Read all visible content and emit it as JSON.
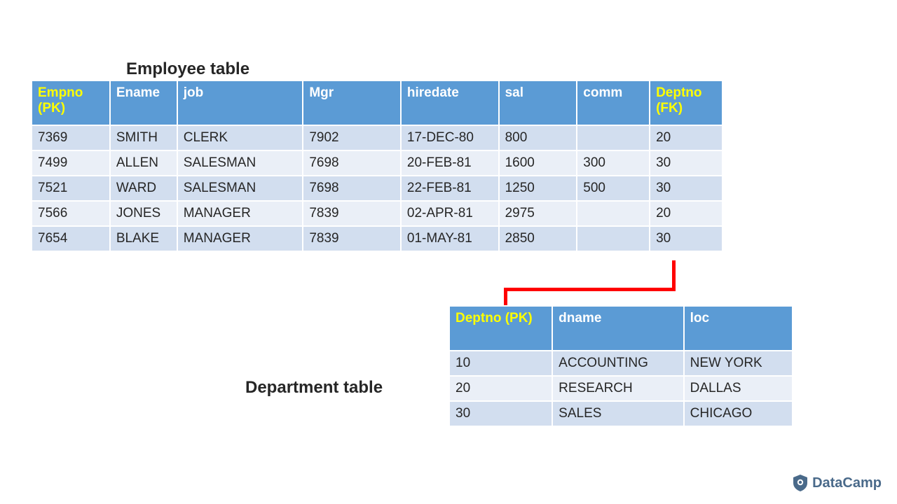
{
  "employee": {
    "title": "Employee table",
    "headers": [
      {
        "label": "Empno\n(PK)",
        "key": true
      },
      {
        "label": "Ename"
      },
      {
        "label": "job"
      },
      {
        "label": "Mgr"
      },
      {
        "label": "hiredate"
      },
      {
        "label": "sal"
      },
      {
        "label": "comm"
      },
      {
        "label": "Deptno\n(FK)",
        "key": true
      }
    ],
    "rows": [
      [
        "7369",
        "SMITH",
        "CLERK",
        "7902",
        "17-DEC-80",
        "800",
        "",
        "20"
      ],
      [
        "7499",
        "ALLEN",
        "SALESMAN",
        "7698",
        "20-FEB-81",
        "1600",
        "300",
        "30"
      ],
      [
        "7521",
        "WARD",
        "SALESMAN",
        "7698",
        "22-FEB-81",
        "1250",
        "500",
        "30"
      ],
      [
        "7566",
        "JONES",
        "MANAGER",
        "7839",
        "02-APR-81",
        "2975",
        "",
        "20"
      ],
      [
        "7654",
        "BLAKE",
        "MANAGER",
        "7839",
        "01-MAY-81",
        "2850",
        "",
        "30"
      ]
    ]
  },
  "department": {
    "title": "Department table",
    "headers": [
      {
        "label": "Deptno\n(PK)",
        "key": true
      },
      {
        "label": "dname"
      },
      {
        "label": "loc"
      }
    ],
    "rows": [
      [
        "10",
        "ACCOUNTING",
        "NEW YORK"
      ],
      [
        "20",
        "RESEARCH",
        "DALLAS"
      ],
      [
        "30",
        "SALES",
        "CHICAGO"
      ]
    ]
  },
  "brand": {
    "name": "DataCamp"
  },
  "colors": {
    "header_bg": "#5b9bd5",
    "header_fg": "#ffffff",
    "key_fg": "#ffff00",
    "band1": "#d2deef",
    "band2": "#eaeff7",
    "connector": "#ff0000"
  }
}
